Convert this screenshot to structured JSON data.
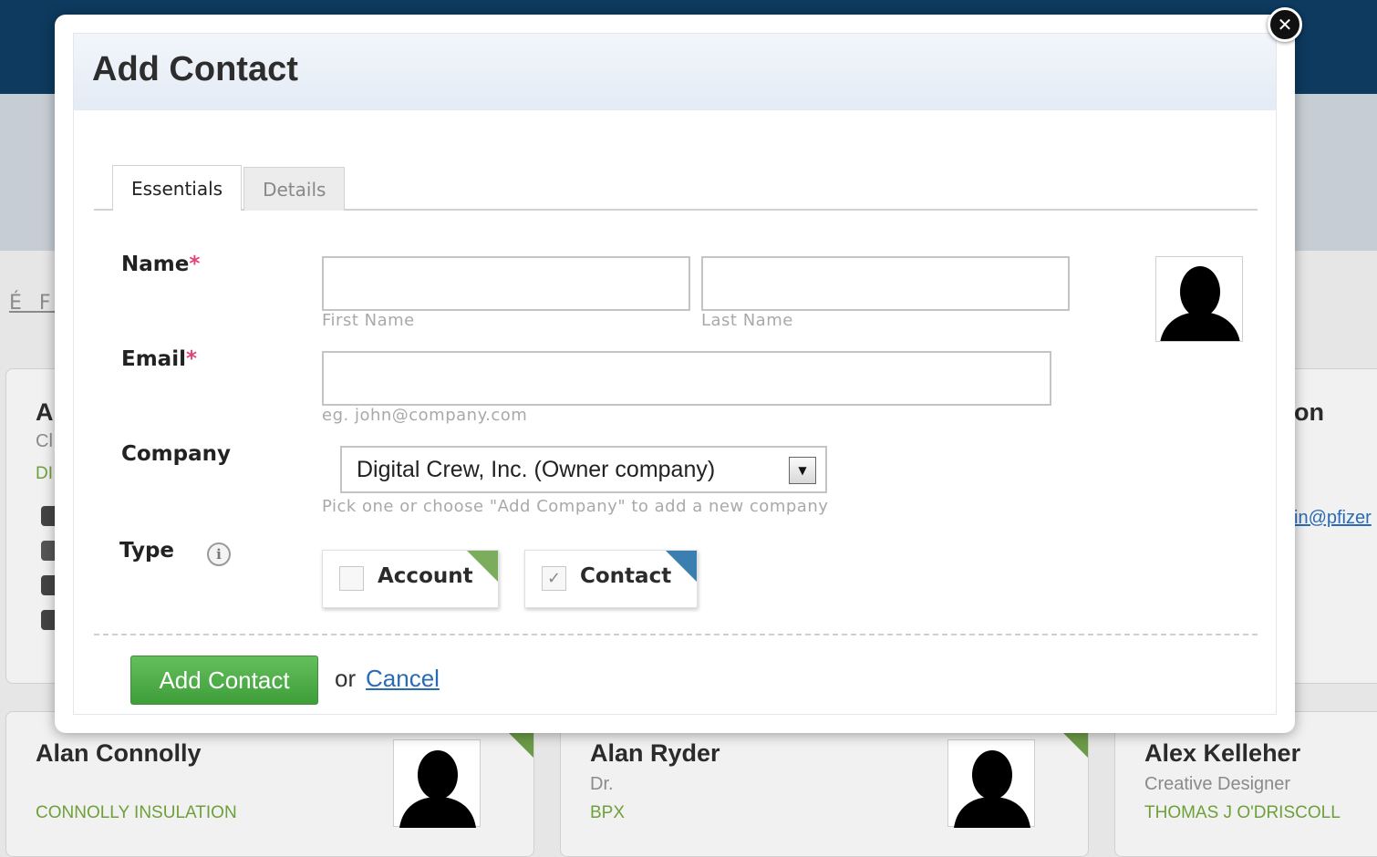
{
  "background": {
    "nav_letters": "É F",
    "cards": [
      {
        "name": "A",
        "title": "Cl",
        "company": "DI"
      },
      {
        "name": "on",
        "email_fragment": "in@pfizer"
      },
      {
        "name": "Alan Connolly",
        "title": "",
        "company": "CONNOLLY INSULATION"
      },
      {
        "name": "Alan Ryder",
        "title": "Dr.",
        "company": "BPX"
      },
      {
        "name": "Alex Kelleher",
        "title": "Creative Designer",
        "company": "THOMAS J O'DRISCOLL"
      }
    ]
  },
  "modal": {
    "title": "Add Contact",
    "close_glyph": "✕",
    "tabs": [
      {
        "label": "Essentials",
        "active": true
      },
      {
        "label": "Details",
        "active": false
      }
    ],
    "name": {
      "label": "Name",
      "required_mark": "*",
      "first": {
        "value": "",
        "hint": "First Name"
      },
      "last": {
        "value": "",
        "hint": "Last Name"
      }
    },
    "email": {
      "label": "Email",
      "required_mark": "*",
      "value": "",
      "hint": "eg. john@company.com"
    },
    "company": {
      "label": "Company",
      "selected": "Digital Crew, Inc. (Owner company)",
      "hint": "Pick one or choose \"Add Company\" to add a new company"
    },
    "type": {
      "label": "Type",
      "info_glyph": "i",
      "options": [
        {
          "label": "Account",
          "checked": false,
          "corner_color": "#7cad5c"
        },
        {
          "label": "Contact",
          "checked": true,
          "check_glyph": "✓",
          "corner_color": "#3b7fb0"
        }
      ]
    },
    "actions": {
      "submit_label": "Add Contact",
      "or_text": "or",
      "cancel_label": "Cancel"
    }
  },
  "colors": {
    "accent_green": "#4cae45",
    "link_blue": "#2a6bb5",
    "required_pink": "#e0457b",
    "topbar_navy": "#0d3a5e"
  },
  "icons": {
    "close": "close-icon",
    "info": "info-icon",
    "avatar": "person-silhouette-icon",
    "dropdown": "chevron-down-icon"
  }
}
